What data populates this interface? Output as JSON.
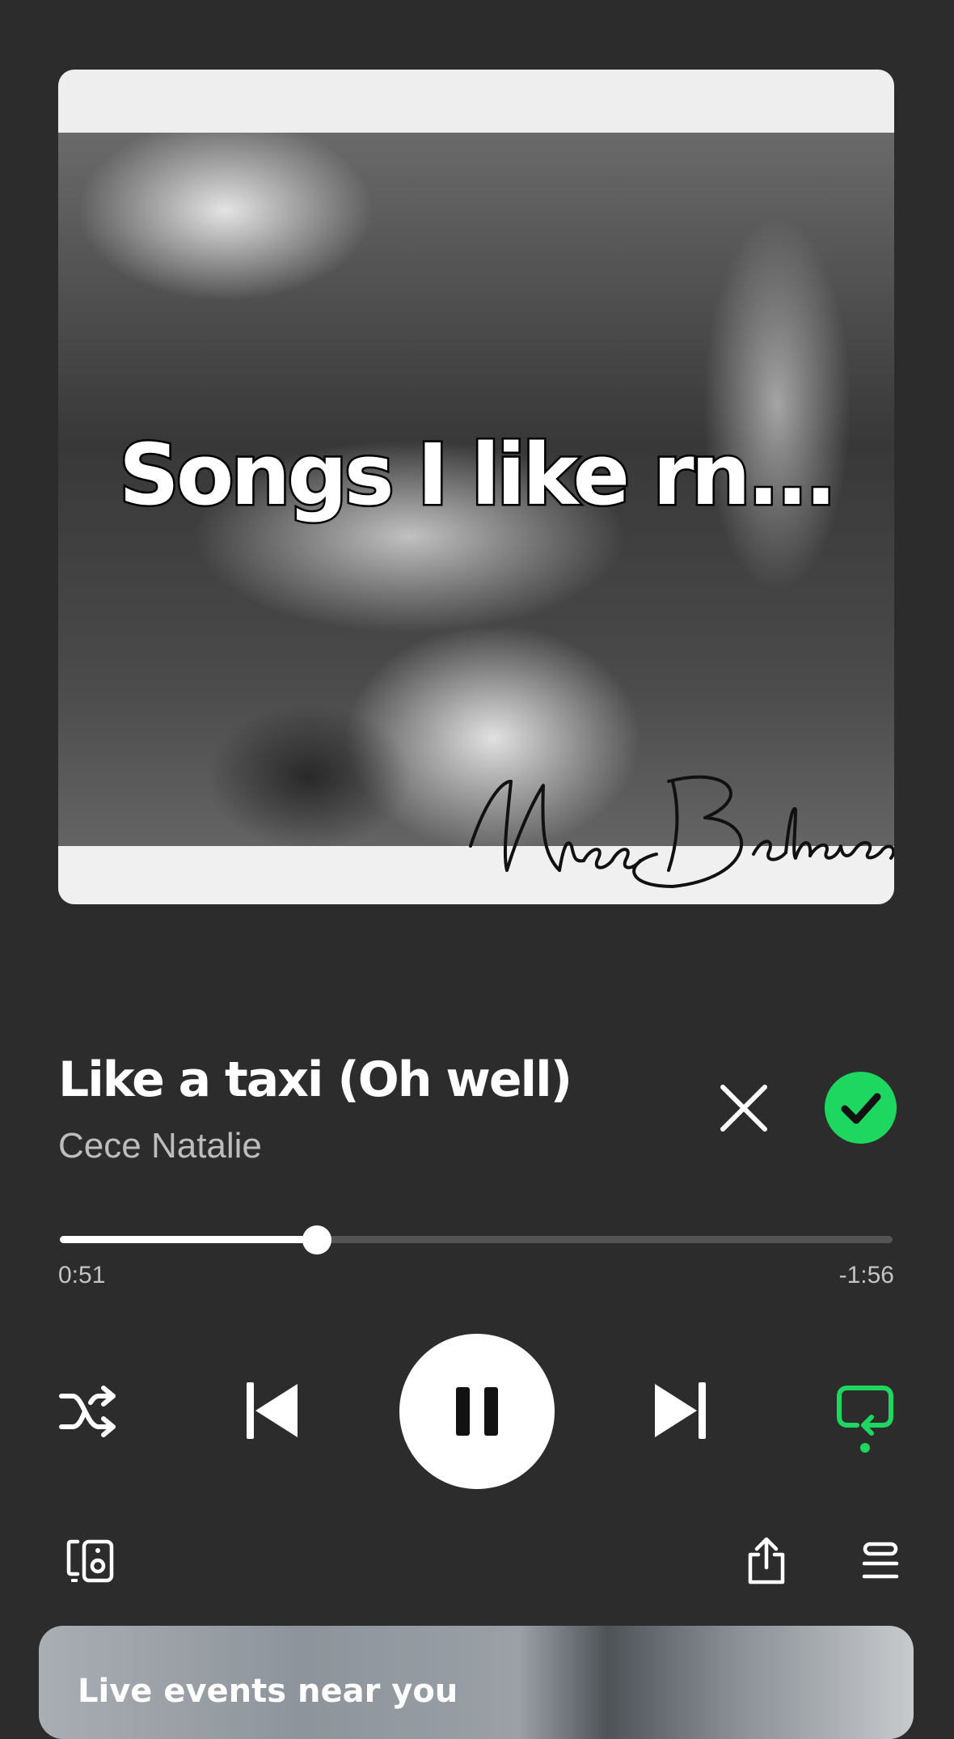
{
  "album_art": {
    "overlay_text": "Songs I like rn...",
    "signature_text": "Miss Behaves"
  },
  "track": {
    "title": "Like a taxi (Oh well)",
    "artist": "Cece Natalie"
  },
  "progress": {
    "elapsed": "0:51",
    "remaining": "-1:56",
    "fraction": 0.309
  },
  "colors": {
    "background": "#2c2c2c",
    "accent": "#1ed760"
  },
  "icons": {
    "dislike": "close-icon",
    "liked": "check-circle-icon",
    "shuffle": "shuffle-icon",
    "previous": "skip-previous-icon",
    "play_state": "pause-icon",
    "next": "skip-next-icon",
    "repeat": "repeat-icon",
    "devices": "connect-devices-icon",
    "share": "share-icon",
    "queue": "queue-icon"
  },
  "state": {
    "playing": true,
    "liked": true,
    "repeat_active": true
  },
  "events_card": {
    "title": "Live events near you"
  }
}
